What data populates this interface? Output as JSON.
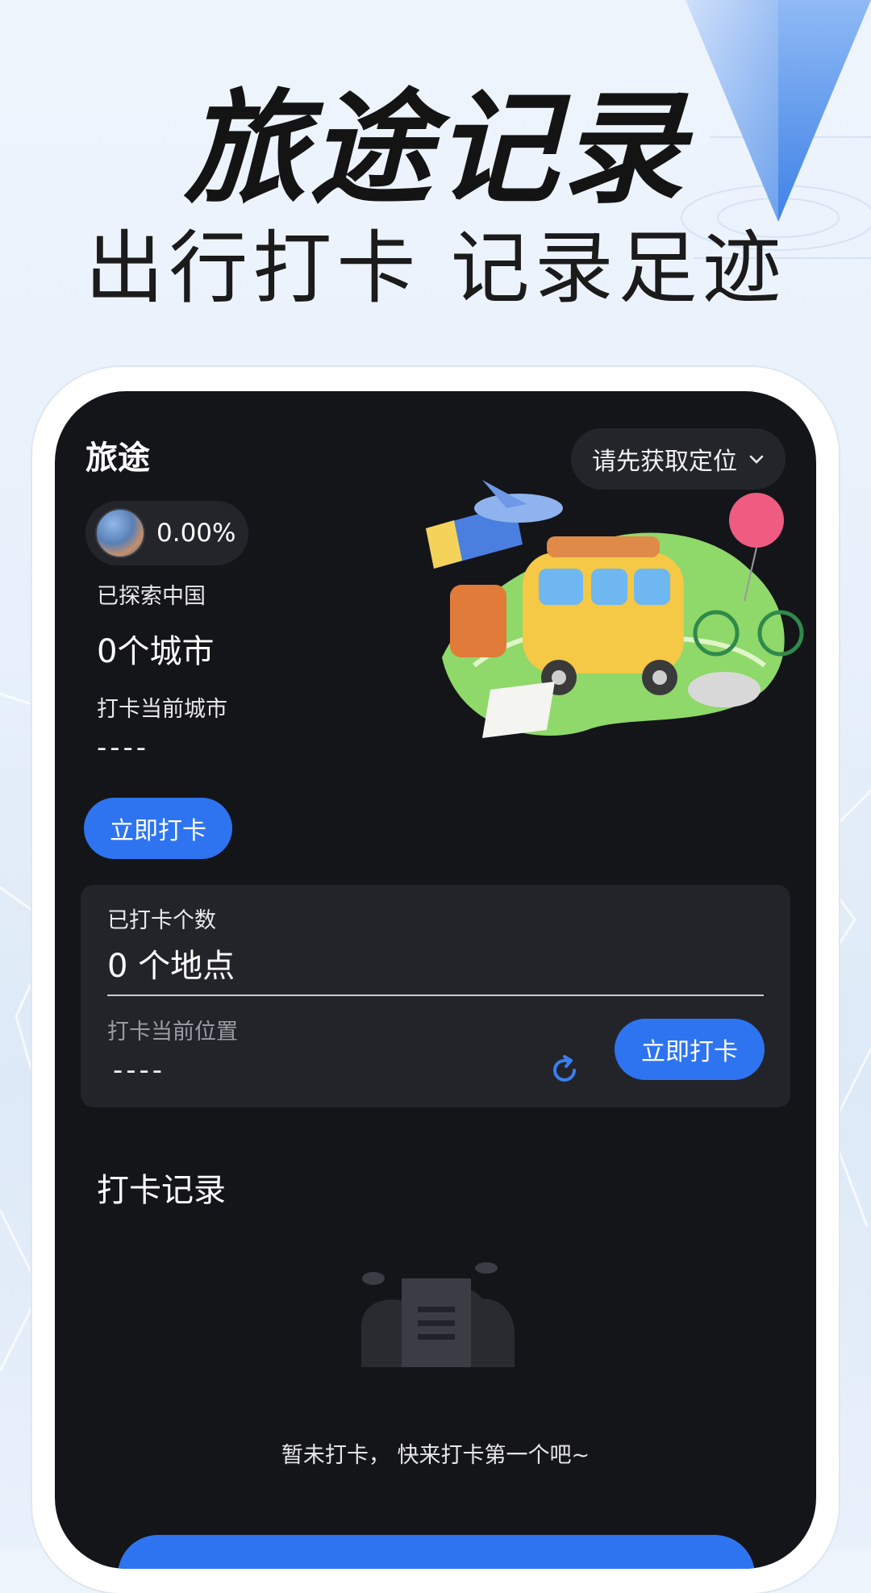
{
  "marketing": {
    "title": "旅途记录",
    "subtitle": "出行打卡 记录足迹"
  },
  "header": {
    "app_title": "旅途",
    "location_label": "请先获取定位"
  },
  "explore": {
    "percent": "0.00%",
    "explored_label": "已探索中国",
    "cities_value": "0个城市",
    "checkin_city_label": "打卡当前城市",
    "current_city": "----",
    "checkin_button": "立即打卡"
  },
  "stats": {
    "count_label": "已打卡个数",
    "count_value": "0 个地点",
    "position_label": "打卡当前位置",
    "position_value": "----",
    "checkin_button": "立即打卡"
  },
  "records": {
    "section_title": "打卡记录",
    "empty_text": "暂未打卡， 快来打卡第一个吧~"
  },
  "colors": {
    "accent": "#2e74f0",
    "screen_bg": "#141519",
    "card_bg": "#22242a"
  },
  "icons": [
    "chevron-down-icon",
    "avatar-globe-icon",
    "refresh-icon",
    "empty-document-icon",
    "map-pin-icon"
  ]
}
